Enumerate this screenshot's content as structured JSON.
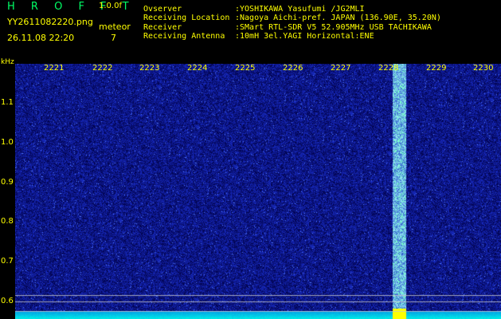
{
  "header": {
    "app_title": "H R O F F T",
    "app_version": "1.0.0f",
    "file_name": "YY2611082220.png",
    "date_time": "26.11.08 22:20",
    "meteor_label": "meteor",
    "meteor_count": "7"
  },
  "info": [
    {
      "label": "Ovserver",
      "value": ":YOSHIKAWA Yasufumi /JG2MLI"
    },
    {
      "label": "Receiving Location",
      "value": ":Nagoya Aichi-pref. JAPAN (136.90E, 35.20N)"
    },
    {
      "label": "Receiver",
      "value": ":SMart RTL-SDR V5 52.905MHz USB TACHIKAWA"
    },
    {
      "label": "Receiving Antenna",
      "value": ":10mH 3el.YAGI Horizontal:ENE"
    }
  ],
  "axis": {
    "unit_label": "kHz",
    "y_ticks": [
      "1.1",
      "1.0",
      "0.9",
      "0.8",
      "0.7",
      "0.6"
    ],
    "x_ticks": [
      "2221",
      "2222",
      "2223",
      "2224",
      "2225",
      "2226",
      "2227",
      "2228",
      "2229",
      "2230"
    ]
  },
  "colors": {
    "background": "#000000",
    "label_text": "#ffff00",
    "title_text": "#00ff66",
    "noise_base": "#0a1a8c",
    "meteor_echo": "#7fd8ff",
    "baseline": "#00e5ff"
  }
}
